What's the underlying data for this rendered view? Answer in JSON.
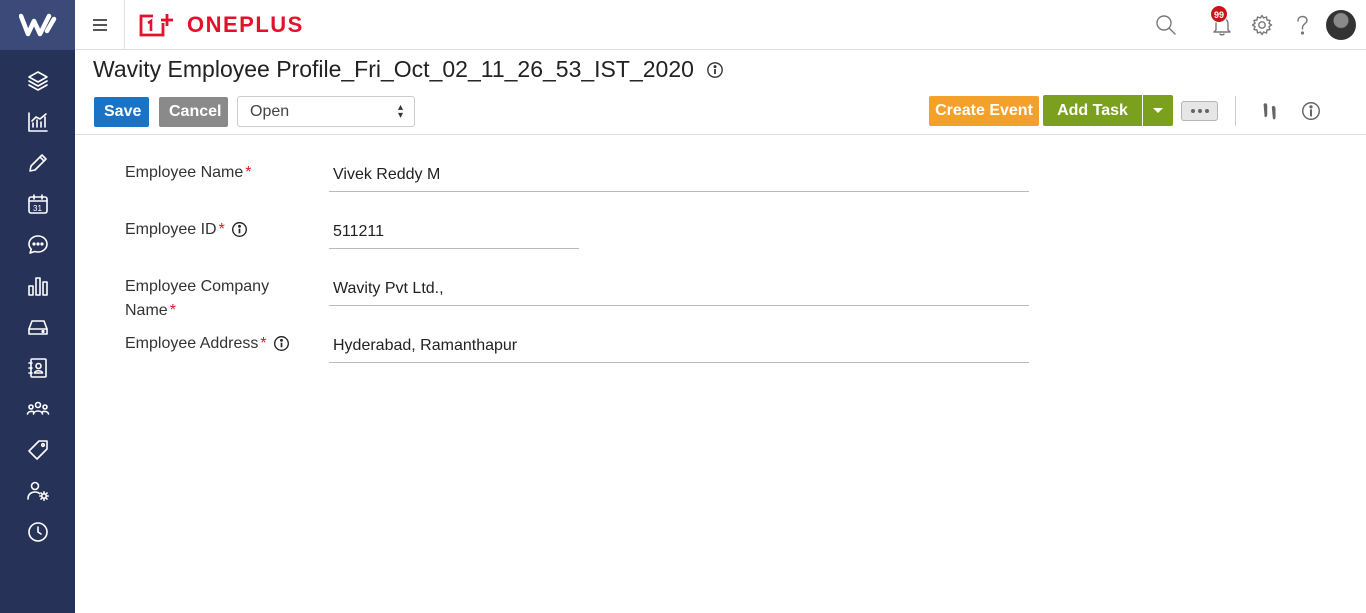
{
  "brand": {
    "name": "ONEPLUS"
  },
  "notifications": {
    "count": "99"
  },
  "page": {
    "title": "Wavity Employee Profile_Fri_Oct_02_11_26_53_IST_2020"
  },
  "toolbar": {
    "save_label": "Save",
    "cancel_label": "Cancel",
    "status_value": "Open",
    "create_event_label": "Create Event",
    "add_task_label": "Add Task"
  },
  "form": {
    "fields": [
      {
        "label": "Employee Name",
        "value": "Vivek Reddy M",
        "required": true,
        "info": false
      },
      {
        "label": "Employee ID",
        "value": "511211",
        "required": true,
        "info": true
      },
      {
        "label": "Employee Company Name",
        "value": "Wavity Pvt Ltd.,",
        "required": true,
        "info": false
      },
      {
        "label": "Employee Address",
        "value": "Hyderabad, Ramanthapur",
        "required": true,
        "info": true
      }
    ]
  },
  "sidebar": {
    "items": [
      "layers-icon",
      "analytics-icon",
      "pencil-icon",
      "calendar-icon",
      "chat-icon",
      "bar-chart-icon",
      "drive-icon",
      "contacts-book-icon",
      "team-icon",
      "tag-icon",
      "user-settings-icon",
      "clock-icon"
    ]
  },
  "colors": {
    "sidebar": "#273258",
    "save": "#1a73c4",
    "cancel": "#8a8a8a",
    "create_event": "#f3a12a",
    "add_task": "#7aa01e",
    "brand_red": "#e4112b"
  }
}
